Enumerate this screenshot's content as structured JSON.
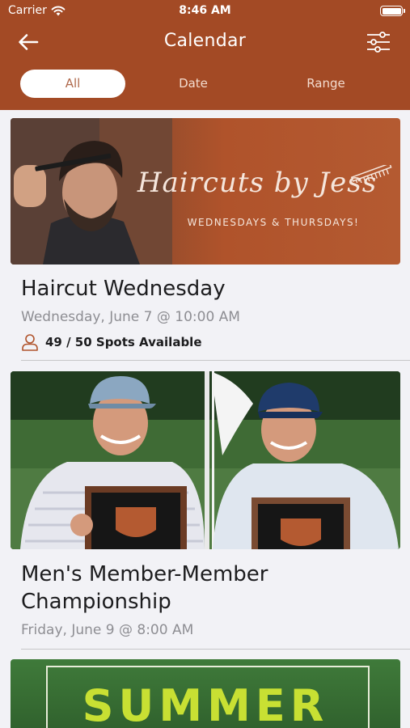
{
  "status_bar": {
    "carrier": "Carrier",
    "time": "8:46 AM"
  },
  "nav": {
    "title": "Calendar",
    "back_icon": "arrow-left-icon",
    "filter_icon": "sliders-icon"
  },
  "segments": [
    {
      "label": "All",
      "active": true
    },
    {
      "label": "Date",
      "active": false
    },
    {
      "label": "Range",
      "active": false
    }
  ],
  "colors": {
    "brand": "#a34a25",
    "background": "#f2f2f6",
    "active_segment_text": "#b06a4d",
    "spots_icon": "#b0532b"
  },
  "events": [
    {
      "banner_script": "Haircuts by Jess",
      "banner_subtitle": "WEDNESDAYS & THURSDAYS!",
      "title": "Haircut Wednesday",
      "date": "Wednesday, June 7 @ 10:00 AM",
      "spots": "49 / 50 Spots Available"
    },
    {
      "title": "Men's Member-Member Championship",
      "title_line1": "Men's Member-Member",
      "title_line2": "Championship",
      "date": "Friday, June 9 @ 8:00 AM"
    },
    {
      "banner_text": "SUMMER"
    }
  ]
}
